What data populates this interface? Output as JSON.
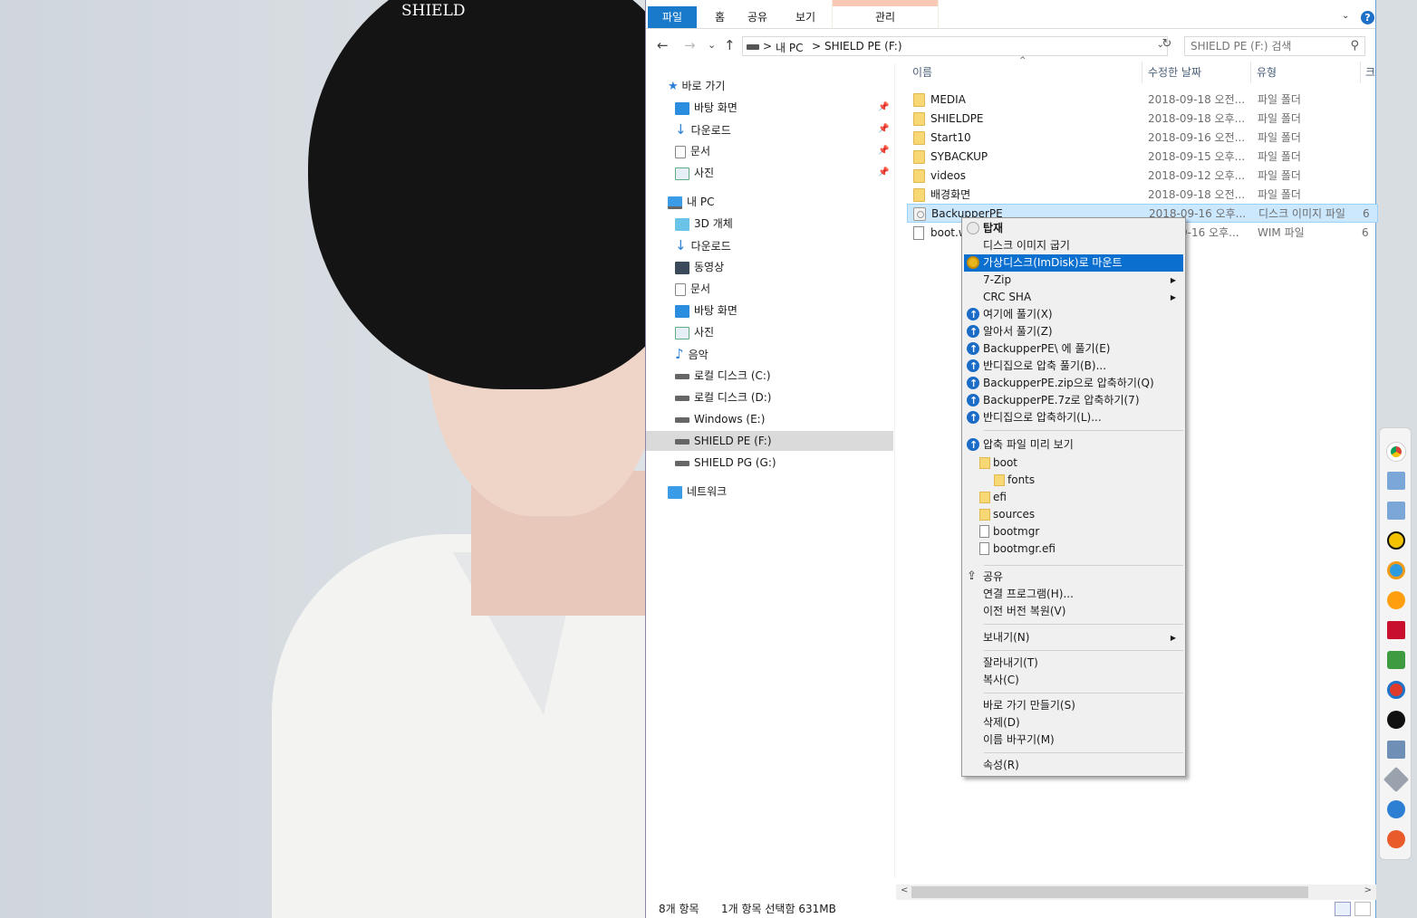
{
  "desktop": {
    "title": "SHIELD"
  },
  "ribbon": {
    "tabs": [
      "파일",
      "홈",
      "공유",
      "보기"
    ],
    "context_tab": "관리",
    "help": "?"
  },
  "address": {
    "back": "←",
    "forward": "→",
    "recent": "⌄",
    "up": "↑",
    "crumbs": [
      "내 PC",
      "SHIELD PE (F:)"
    ],
    "separator": ">",
    "search_placeholder": "SHIELD PE (F:) 검색"
  },
  "nav": {
    "quick_access": "바로 가기",
    "quick_items": [
      "바탕 화면",
      "다운로드",
      "문서",
      "사진"
    ],
    "pin": "📌",
    "this_pc": "내 PC",
    "pc_items": [
      "3D 개체",
      "다운로드",
      "동영상",
      "문서",
      "바탕 화면",
      "사진",
      "음악",
      "로컬 디스크 (C:)",
      "로컬 디스크 (D:)",
      "Windows (E:)",
      "SHIELD PE (F:)",
      "SHIELD PG (G:)"
    ],
    "network": "네트워크"
  },
  "columns": {
    "name": "이름",
    "date": "수정한 날짜",
    "type": "유형",
    "size": "크"
  },
  "files": [
    {
      "name": "MEDIA",
      "date": "2018-09-18 오전...",
      "type": "파일 폴더",
      "size": ""
    },
    {
      "name": "SHIELDPE",
      "date": "2018-09-18 오후...",
      "type": "파일 폴더",
      "size": ""
    },
    {
      "name": "Start10",
      "date": "2018-09-16 오전...",
      "type": "파일 폴더",
      "size": ""
    },
    {
      "name": "SYBACKUP",
      "date": "2018-09-15 오후...",
      "type": "파일 폴더",
      "size": ""
    },
    {
      "name": "videos",
      "date": "2018-09-12 오후...",
      "type": "파일 폴더",
      "size": ""
    },
    {
      "name": "배경화면",
      "date": "2018-09-18 오전...",
      "type": "파일 폴더",
      "size": ""
    },
    {
      "name": "BackupperPE",
      "date": "2018-09-16 오후...",
      "type": "디스크 이미지 파일",
      "size": "6"
    },
    {
      "name": "boot.w",
      "date": "9-16 오후...",
      "type": "WIM 파일",
      "size": "6"
    }
  ],
  "status": {
    "count": "8개 항목",
    "selection": "1개 항목 선택함 631MB"
  },
  "menu": {
    "mount": "탑재",
    "burn": "디스크 이미지 굽기",
    "imdisk": "가상디스크(ImDisk)로 마운트",
    "zip7": "7-Zip",
    "crc": "CRC SHA",
    "extract_here": "여기에 풀기(X)",
    "extract_auto": "알아서 풀기(Z)",
    "extract_to": "BackupperPE\\ 에 풀기(E)",
    "extract_bandizip": "반디집으로 압축 풀기(B)...",
    "compress_zip": "BackupperPE.zip으로 압축하기(Q)",
    "compress_7z": "BackupperPE.7z로 압축하기(7)",
    "compress_bandizip": "반디집으로 압축하기(L)...",
    "preview": "압축 파일 미리 보기",
    "tree": [
      "boot",
      "fonts",
      "efi",
      "sources",
      "bootmgr",
      "bootmgr.efi"
    ],
    "share": "공유",
    "open_with": "연결 프로그램(H)...",
    "restore": "이전 버전 복원(V)",
    "send_to": "보내기(N)",
    "cut": "잘라내기(T)",
    "copy": "복사(C)",
    "shortcut": "바로 가기 만들기(S)",
    "delete": "삭제(D)",
    "rename": "이름 바꾸기(M)",
    "properties": "속성(R)",
    "arrow": "▶"
  },
  "colors": {
    "accent": "#0a6fcf",
    "folder": "#f8d775",
    "selection": "#cce8ff",
    "file_tab": "#1979ca"
  }
}
